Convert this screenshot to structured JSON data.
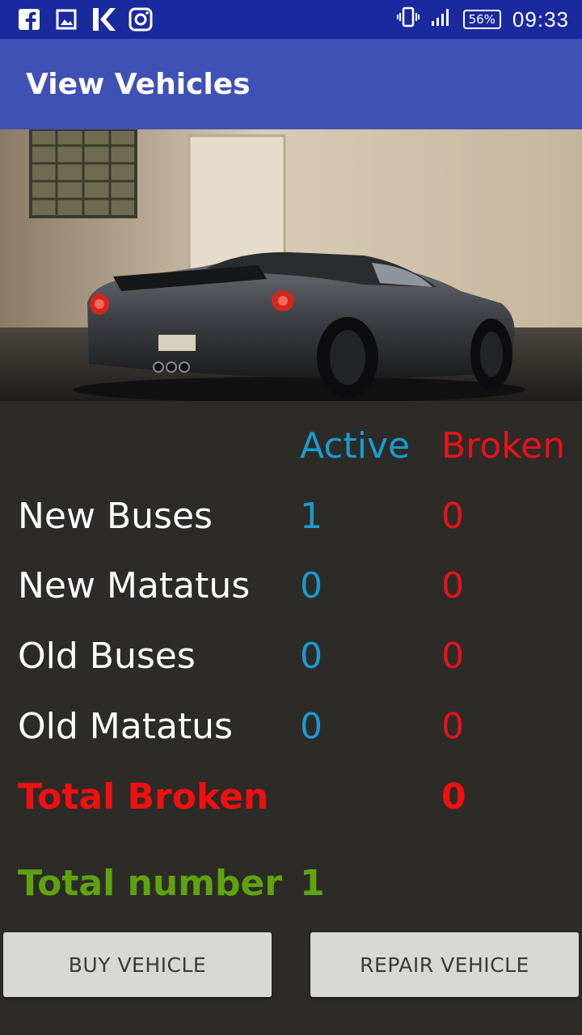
{
  "status_bar": {
    "icons_left": [
      "facebook-icon",
      "gallery-icon",
      "k-app-icon",
      "instagram-icon"
    ],
    "battery": "56%",
    "time": "09:33"
  },
  "app_bar": {
    "title": "View Vehicles"
  },
  "hero": {
    "subject": "car-photo"
  },
  "table": {
    "header_active": "Active",
    "header_broken": "Broken",
    "rows": [
      {
        "label": "New Buses",
        "active": "1",
        "broken": "0"
      },
      {
        "label": "New Matatus",
        "active": "0",
        "broken": "0"
      },
      {
        "label": "Old Buses",
        "active": "0",
        "broken": "0"
      },
      {
        "label": "Old Matatus",
        "active": "0",
        "broken": "0"
      }
    ],
    "total_broken_label": "Total Broken",
    "total_broken_value": "0",
    "total_number_label": "Total number",
    "total_number_value": "1"
  },
  "buttons": {
    "buy": "BUY VEHICLE",
    "repair": "REPAIR VEHICLE"
  },
  "colors": {
    "active": "#1a9bd1",
    "broken": "#e8121a",
    "total_number": "#5fa30e",
    "app_bar": "#3f51b5",
    "status_bar": "#1a2a9e"
  }
}
